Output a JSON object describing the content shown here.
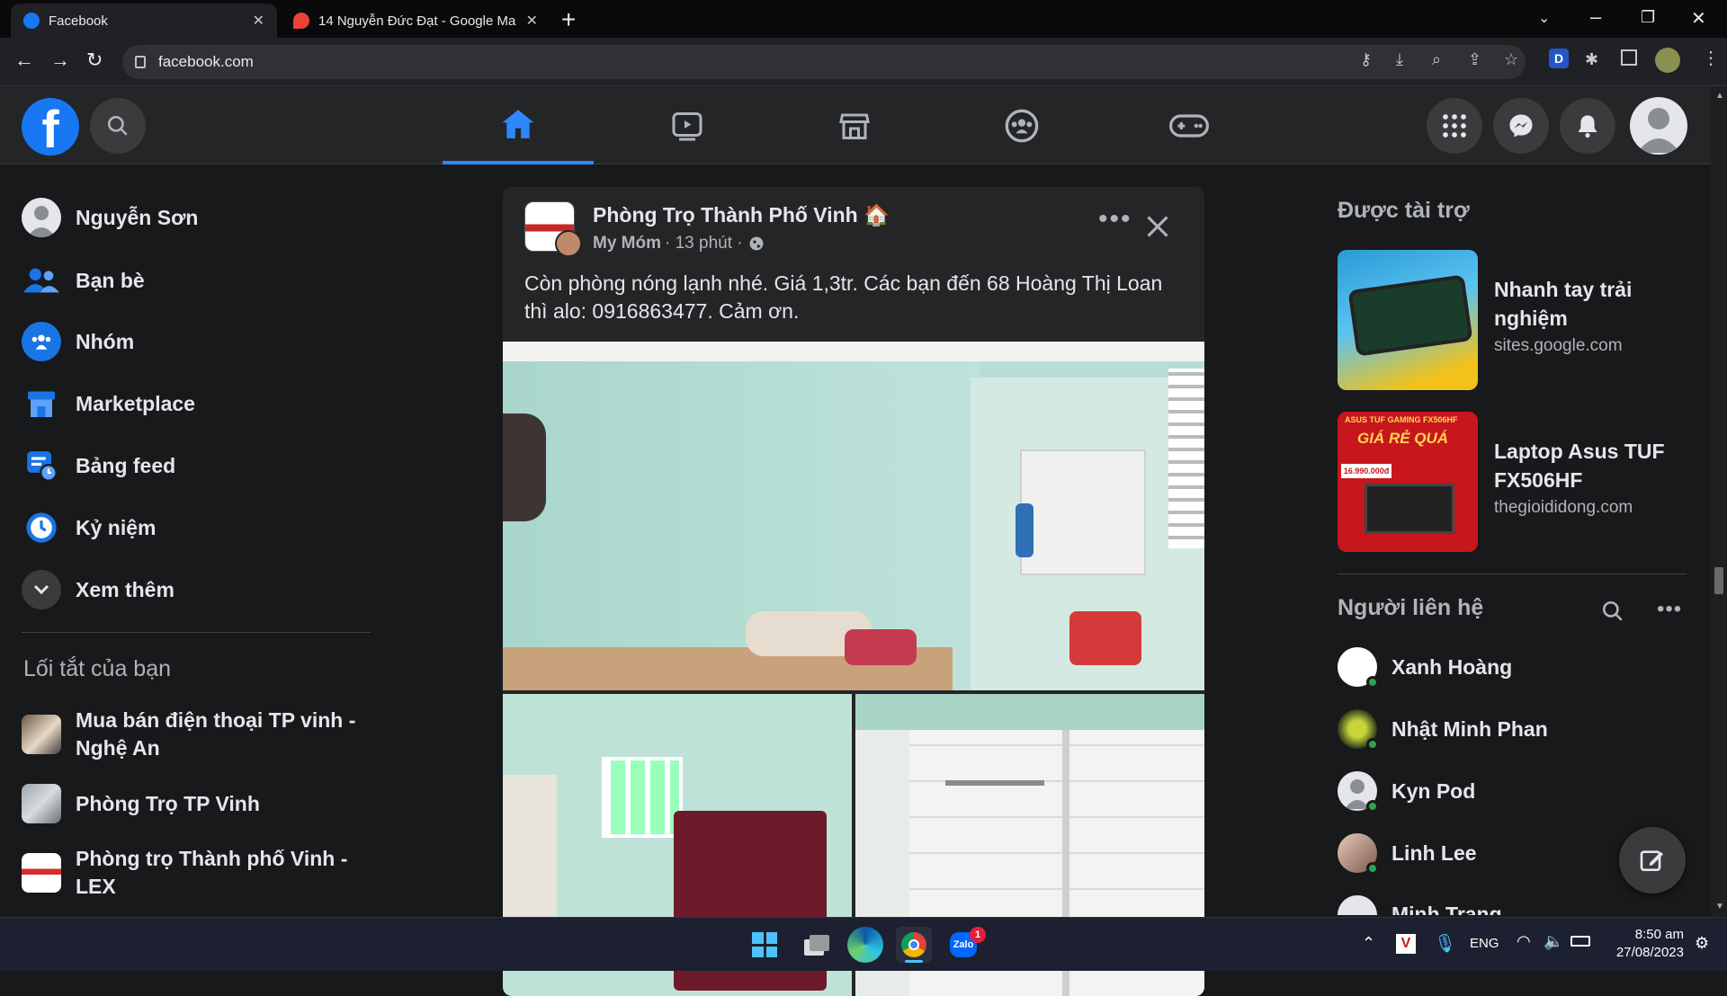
{
  "browser": {
    "tabs": [
      {
        "title": "Facebook",
        "active": true
      },
      {
        "title": "14 Nguyễn Đức Đạt - Google Ma",
        "active": false
      }
    ],
    "url": "facebook.com"
  },
  "left_nav": {
    "profile_name": "Nguyễn Sơn",
    "items": [
      {
        "label": "Bạn bè",
        "icon": "friends-icon"
      },
      {
        "label": "Nhóm",
        "icon": "groups-icon"
      },
      {
        "label": "Marketplace",
        "icon": "marketplace-icon"
      },
      {
        "label": "Bảng feed",
        "icon": "feeds-icon"
      },
      {
        "label": "Kỷ niệm",
        "icon": "memories-icon"
      },
      {
        "label": "Xem thêm",
        "icon": "chevron-down-icon"
      }
    ],
    "shortcuts_title": "Lối tắt của bạn",
    "shortcuts": [
      {
        "label": "Mua bán điện thoại TP vinh - Nghệ An"
      },
      {
        "label": "Phòng Trọ TP Vinh"
      },
      {
        "label": "Phòng trọ Thành phố Vinh - LEX"
      }
    ]
  },
  "post": {
    "group": "Phòng Trọ Thành Phố Vinh 🏠",
    "author": "My Móm",
    "time": "· 13 phút ·",
    "text": "Còn phòng nóng lạnh nhé. Giá 1,3tr. Các bạn đến 68 Hoàng Thị Loan thì alo: 0916863477. Cảm ơn."
  },
  "right": {
    "sponsored_title": "Được tài trợ",
    "ads": [
      {
        "title": "Nhanh tay trải nghiệm",
        "domain": "sites.google.com"
      },
      {
        "title": "Laptop Asus TUF FX506HF",
        "domain": "thegioididong.com"
      }
    ],
    "ad_image_text": {
      "brand": "ASUS TUF GAMING FX506HF",
      "promo": "GIÁ RẺ QUÁ",
      "price": "16.990.000đ"
    },
    "contacts_title": "Người liên hệ",
    "contacts": [
      {
        "name": "Xanh Hoàng"
      },
      {
        "name": "Nhật Minh Phan"
      },
      {
        "name": "Kyn Pod"
      },
      {
        "name": "Linh Lee"
      },
      {
        "name": "Minh Trang"
      }
    ]
  },
  "taskbar": {
    "lang": "ENG",
    "time": "8:50 am",
    "date": "27/08/2023",
    "zalo_badge": "1",
    "zalo_label": "Zalo"
  },
  "colors": {
    "accent": "#2d88ff",
    "bg": "#18191a",
    "card": "#242526",
    "online": "#31a24c"
  }
}
